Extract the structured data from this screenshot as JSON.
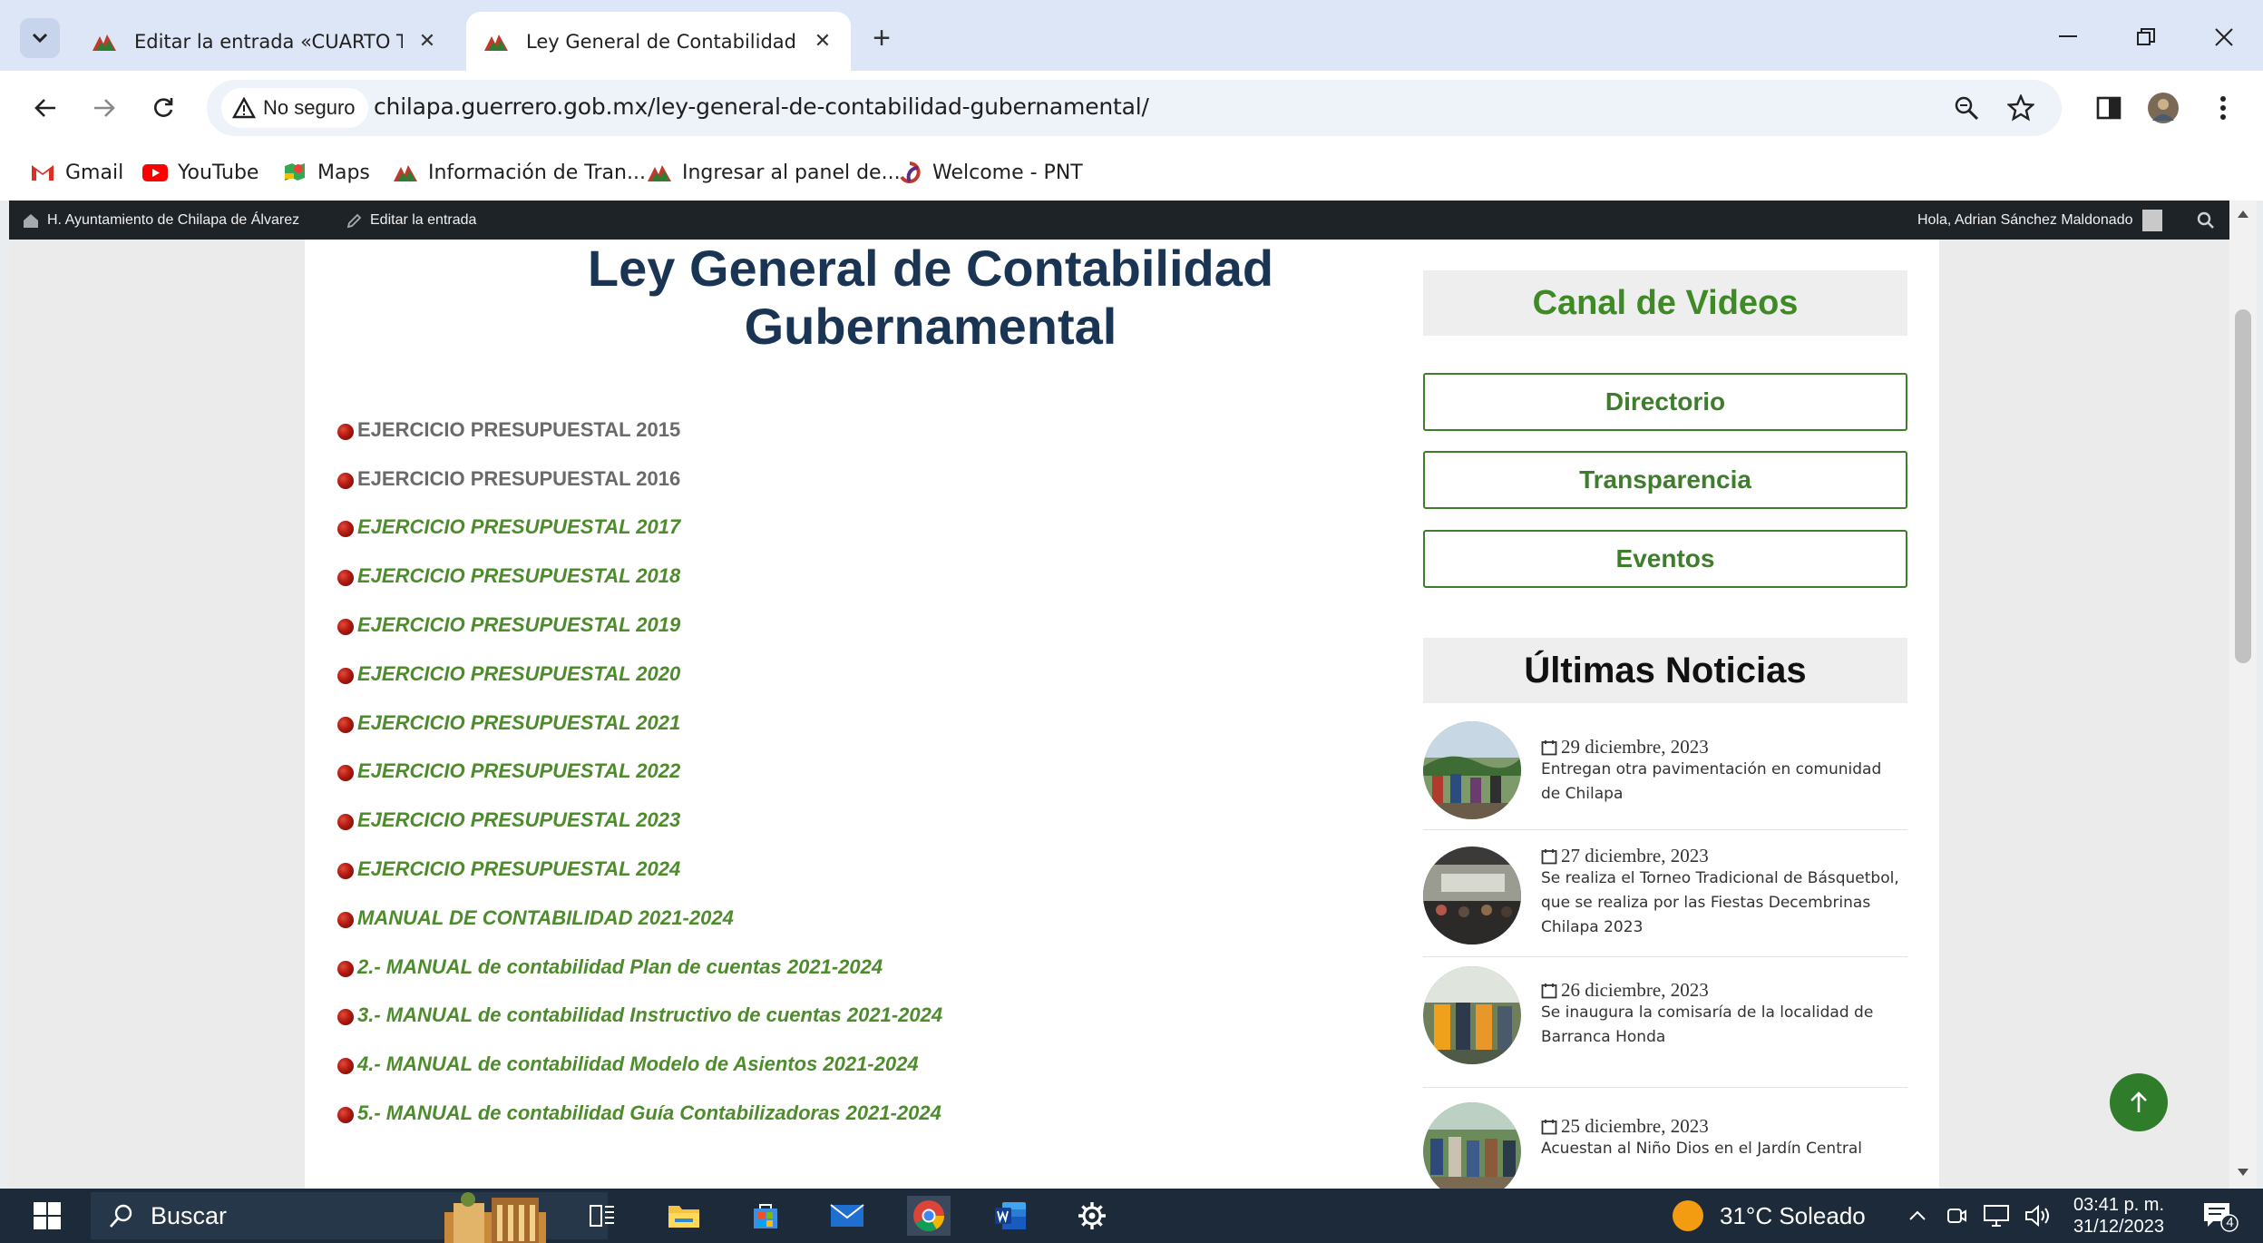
{
  "browser": {
    "tabs": [
      {
        "title": "Editar la entrada «CUARTO TRIM",
        "active": false
      },
      {
        "title": "Ley General de Contabilidad Gu",
        "active": true
      }
    ],
    "security_label": "No seguro",
    "url": "chilapa.guerrero.gob.mx/ley-general-de-contabilidad-gubernamental/",
    "bookmarks": [
      "Gmail",
      "YouTube",
      "Maps",
      "Información de Tran...",
      "Ingresar al panel de...",
      "Welcome - PNT"
    ]
  },
  "admin_bar": {
    "site_name": "H. Ayuntamiento de Chilapa de Álvarez",
    "edit_label": "Editar la entrada",
    "greeting": "Hola, Adrian Sánchez Maldonado"
  },
  "page": {
    "title_line1": "Ley General de Contabilidad",
    "title_line2": "Gubernamental",
    "documents": [
      {
        "text": "EJERCICIO PRESUPUESTAL 2015",
        "style": "plain"
      },
      {
        "text": "EJERCICIO PRESUPUESTAL 2016",
        "style": "plain"
      },
      {
        "text": "EJERCICIO PRESUPUESTAL  2017",
        "style": "link"
      },
      {
        "text": "EJERCICIO PRESUPUESTAL 2018",
        "style": "link"
      },
      {
        "text": "EJERCICIO PRESUPUESTAL 2019",
        "style": "link"
      },
      {
        "text": "EJERCICIO PRESUPUESTAL 2020",
        "style": "link"
      },
      {
        "text": "EJERCICIO PRESUPUESTAL 2021",
        "style": "link"
      },
      {
        "text": "EJERCICIO PRESUPUESTAL 2022",
        "style": "link"
      },
      {
        "text": "EJERCICIO PRESUPUESTAL 2023",
        "style": "link"
      },
      {
        "text": "EJERCICIO PRESUPUESTAL 2024",
        "style": "link"
      },
      {
        "text": "MANUAL DE CONTABILIDAD 2021-2024",
        "style": "link"
      },
      {
        "text": "2.- MANUAL de contabilidad Plan de cuentas 2021-2024",
        "style": "link"
      },
      {
        "text": "3.- MANUAL de contabilidad Instructivo de cuentas 2021-2024",
        "style": "link"
      },
      {
        "text": "4.- MANUAL de contabilidad Modelo de Asientos 2021-2024",
        "style": "link"
      },
      {
        "text": "5.- MANUAL de contabilidad Guía Contabilizadoras 2021-2024",
        "style": "link"
      }
    ]
  },
  "sidebar": {
    "canal_title": "Canal de Videos",
    "buttons": [
      "Directorio",
      "Transparencia",
      "Eventos"
    ],
    "news_title": "Últimas Noticias",
    "news": [
      {
        "date": "29 diciembre, 2023",
        "text": "Entregan otra pavimentación en comunidad de Chilapa"
      },
      {
        "date": "27 diciembre, 2023",
        "text": "Se realiza el Torneo Tradicional de Básquetbol, que se realiza por las Fiestas Decembrinas Chilapa 2023"
      },
      {
        "date": "26 diciembre, 2023",
        "text": "Se inaugura la comisaría de la localidad de Barranca Honda"
      },
      {
        "date": "25 diciembre, 2023",
        "text": "Acuestan al Niño Dios en el Jardín Central"
      }
    ]
  },
  "taskbar": {
    "search_label": "Buscar",
    "weather": "31°C  Soleado",
    "time": "03:41 p. m.",
    "date": "31/12/2023",
    "notifications": "4"
  },
  "colors": {
    "title_navy": "#1a3553",
    "link_green": "#4e8b2c",
    "button_green": "#3d7d2c",
    "admin_bar": "#1d2327",
    "taskbar": "#1c2a3a"
  }
}
